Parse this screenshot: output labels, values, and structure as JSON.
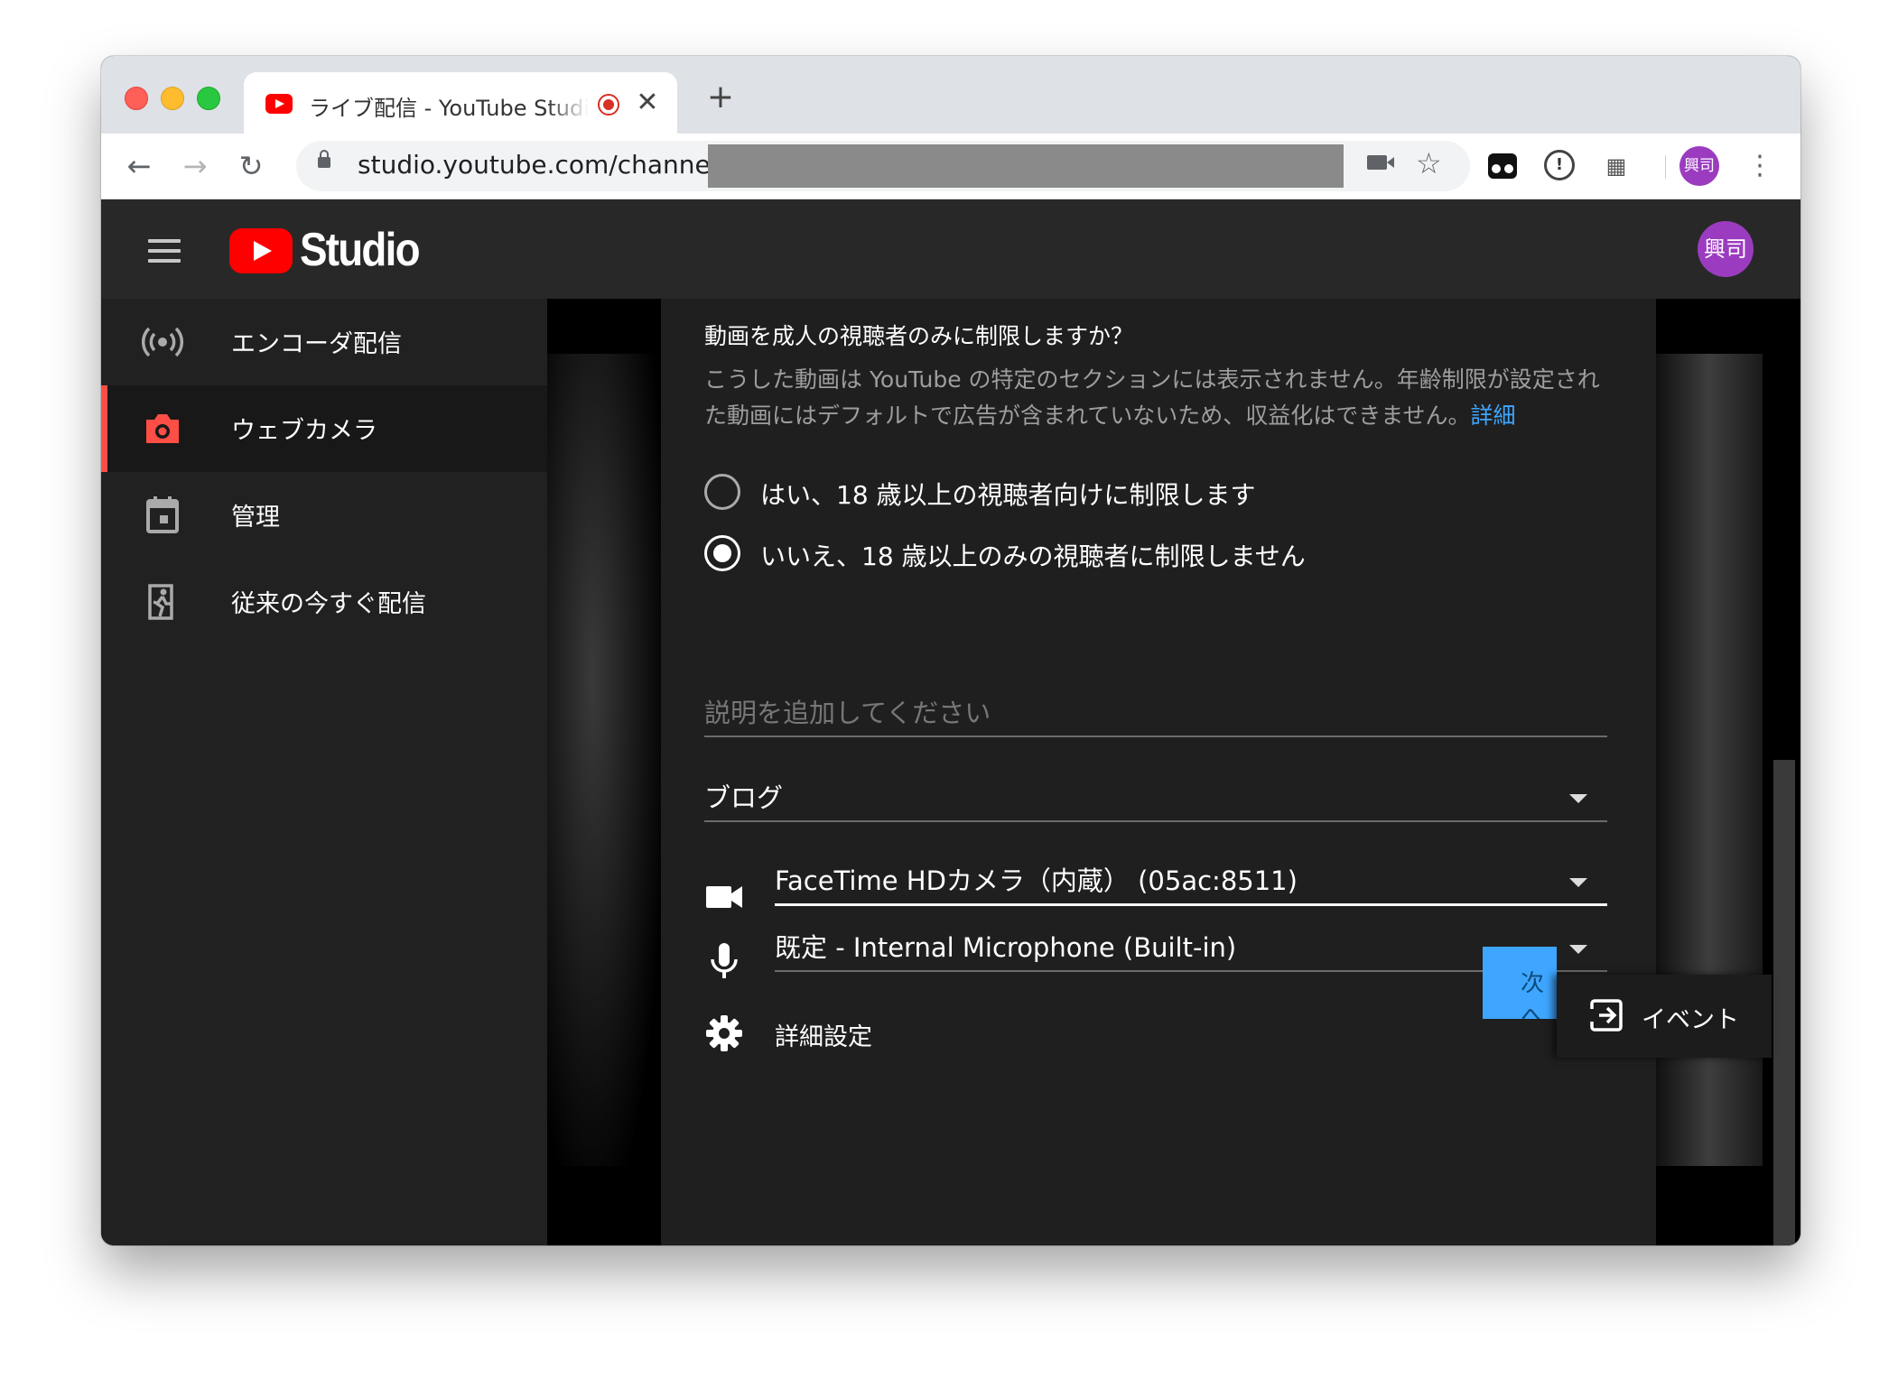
{
  "browser": {
    "tab_title": "ライブ配信 - YouTube Studio",
    "new_tab": "+",
    "close": "✕",
    "url": "studio.youtube.com/channel/",
    "profile_initials": "興司"
  },
  "studio": {
    "logo_text": "Studio",
    "avatar_initials": "興司"
  },
  "sidebar": {
    "items": [
      {
        "label": "エンコーダ配信",
        "icon": "broadcast-icon",
        "active": false
      },
      {
        "label": "ウェブカメラ",
        "icon": "camera-icon",
        "active": true
      },
      {
        "label": "管理",
        "icon": "calendar-icon",
        "active": false
      },
      {
        "label": "従来の今すぐ配信",
        "icon": "exit-run-icon",
        "active": false
      }
    ]
  },
  "dialog": {
    "age_question": "動画を成人の視聴者のみに制限しますか？",
    "age_desc": "こうした動画は YouTube の特定のセクションには表示されません。年齢制限が設定された動画にはデフォルトで広告が含まれていないため、収益化はできません。",
    "age_desc_link": "詳細",
    "radio_yes": "はい、18 歳以上の視聴者向けに制限します",
    "radio_no": "いいえ、18 歳以上のみの視聴者に制限しません",
    "radio_selected": "no",
    "description_placeholder": "説明を追加してください",
    "category_value": "ブログ",
    "camera_value": "FaceTime HDカメラ（内蔵） (05ac:8511)",
    "mic_value": "既定 - Internal Microphone (Built-in)",
    "advanced_label": "詳細設定",
    "next_label": "次へ",
    "event_label": "イベント"
  },
  "colors": {
    "accent_red": "#ff4e45",
    "link_blue": "#3ea6ff",
    "avatar_purple": "#9b3cc0"
  }
}
